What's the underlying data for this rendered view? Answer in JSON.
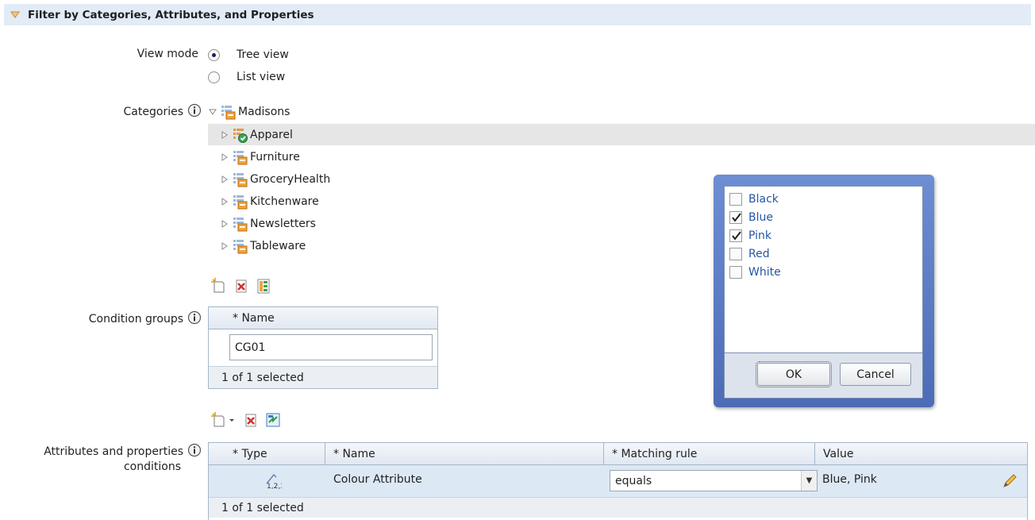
{
  "section": {
    "title": "Filter by Categories, Attributes, and Properties"
  },
  "view_mode": {
    "label": "View mode",
    "options": [
      {
        "label": "Tree view",
        "selected": true
      },
      {
        "label": "List view",
        "selected": false
      }
    ]
  },
  "categories": {
    "label": "Categories",
    "root": "Madisons",
    "items": [
      {
        "label": "Apparel",
        "icon": "category-checked-icon",
        "selected": true
      },
      {
        "label": "Furniture",
        "icon": "category-icon"
      },
      {
        "label": "GroceryHealth",
        "icon": "category-icon"
      },
      {
        "label": "Kitchenware",
        "icon": "category-icon"
      },
      {
        "label": "Newsletters",
        "icon": "category-icon"
      },
      {
        "label": "Tableware",
        "icon": "category-icon"
      }
    ]
  },
  "condition_groups": {
    "label": "Condition groups",
    "column_name": "* Name",
    "name_value": "CG01",
    "footer": "1 of 1 selected"
  },
  "attributes": {
    "label_line1": "Attributes and properties",
    "label_line2": "conditions",
    "columns": {
      "type": "* Type",
      "name": "* Name",
      "rule": "* Matching rule",
      "value": "Value"
    },
    "row": {
      "name": "Colour Attribute",
      "rule": "equals",
      "value": "Blue, Pink"
    },
    "footer": "1 of 1 selected"
  },
  "value_dialog": {
    "options": [
      {
        "label": "Black",
        "checked": false
      },
      {
        "label": "Blue",
        "checked": true
      },
      {
        "label": "Pink",
        "checked": true
      },
      {
        "label": "Red",
        "checked": false
      },
      {
        "label": "White",
        "checked": false
      }
    ],
    "ok_label": "OK",
    "cancel_label": "Cancel"
  },
  "colors": {
    "header_bg": "#e2ebf6",
    "link_blue": "#2457a5",
    "dialog_frame": "#5676bf",
    "row_selected": "#dde8f5"
  }
}
